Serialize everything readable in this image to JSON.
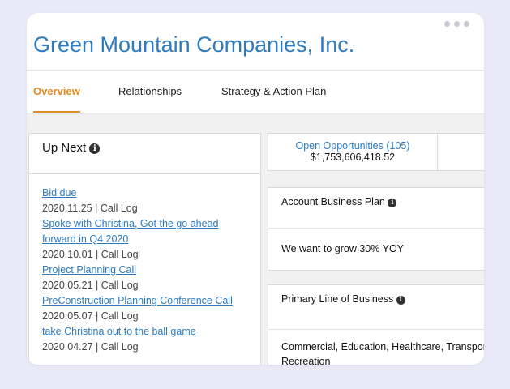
{
  "company": {
    "title": "Green Mountain Companies, Inc."
  },
  "tabs": [
    {
      "label": "Overview"
    },
    {
      "label": "Relationships"
    },
    {
      "label": "Strategy & Action Plan"
    }
  ],
  "up_next": {
    "heading": "Up Next",
    "items": [
      {
        "title": "Bid due",
        "meta": "2020.11.25 | Call Log"
      },
      {
        "title": "Spoke with Christina, Got the go ahead forward in Q4 2020",
        "meta": "2020.10.01 | Call Log"
      },
      {
        "title": "Project Planning Call",
        "meta": "2020.05.21 | Call Log"
      },
      {
        "title": "PreConstruction Planning Conference Call",
        "meta": "2020.05.07 | Call Log"
      },
      {
        "title": "take Christina out to the ball game",
        "meta": "2020.04.27 | Call Log"
      }
    ]
  },
  "opportunities": {
    "label": "Open Opportunities (105)",
    "amount": "$1,753,606,418.52"
  },
  "account_business_plan": {
    "heading": "Account Business Plan",
    "value": "We want to grow 30% YOY"
  },
  "primary_line_of_business": {
    "heading": "Primary Line of Business",
    "value": "Commercial, Education, Healthcare, Transportation, Sports & Recreation"
  }
}
